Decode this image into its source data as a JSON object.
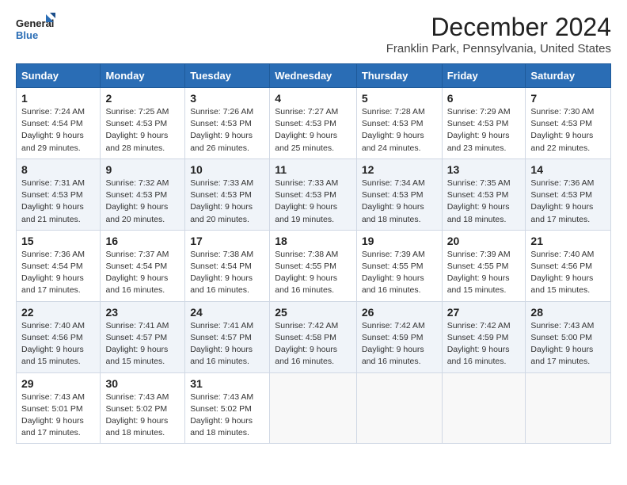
{
  "logo": {
    "line1": "General",
    "line2": "Blue"
  },
  "title": "December 2024",
  "location": "Franklin Park, Pennsylvania, United States",
  "days_of_week": [
    "Sunday",
    "Monday",
    "Tuesday",
    "Wednesday",
    "Thursday",
    "Friday",
    "Saturday"
  ],
  "weeks": [
    [
      {
        "day": "1",
        "sunrise": "7:24 AM",
        "sunset": "4:54 PM",
        "daylight": "9 hours and 29 minutes."
      },
      {
        "day": "2",
        "sunrise": "7:25 AM",
        "sunset": "4:53 PM",
        "daylight": "9 hours and 28 minutes."
      },
      {
        "day": "3",
        "sunrise": "7:26 AM",
        "sunset": "4:53 PM",
        "daylight": "9 hours and 26 minutes."
      },
      {
        "day": "4",
        "sunrise": "7:27 AM",
        "sunset": "4:53 PM",
        "daylight": "9 hours and 25 minutes."
      },
      {
        "day": "5",
        "sunrise": "7:28 AM",
        "sunset": "4:53 PM",
        "daylight": "9 hours and 24 minutes."
      },
      {
        "day": "6",
        "sunrise": "7:29 AM",
        "sunset": "4:53 PM",
        "daylight": "9 hours and 23 minutes."
      },
      {
        "day": "7",
        "sunrise": "7:30 AM",
        "sunset": "4:53 PM",
        "daylight": "9 hours and 22 minutes."
      }
    ],
    [
      {
        "day": "8",
        "sunrise": "7:31 AM",
        "sunset": "4:53 PM",
        "daylight": "9 hours and 21 minutes."
      },
      {
        "day": "9",
        "sunrise": "7:32 AM",
        "sunset": "4:53 PM",
        "daylight": "9 hours and 20 minutes."
      },
      {
        "day": "10",
        "sunrise": "7:33 AM",
        "sunset": "4:53 PM",
        "daylight": "9 hours and 20 minutes."
      },
      {
        "day": "11",
        "sunrise": "7:33 AM",
        "sunset": "4:53 PM",
        "daylight": "9 hours and 19 minutes."
      },
      {
        "day": "12",
        "sunrise": "7:34 AM",
        "sunset": "4:53 PM",
        "daylight": "9 hours and 18 minutes."
      },
      {
        "day": "13",
        "sunrise": "7:35 AM",
        "sunset": "4:53 PM",
        "daylight": "9 hours and 18 minutes."
      },
      {
        "day": "14",
        "sunrise": "7:36 AM",
        "sunset": "4:53 PM",
        "daylight": "9 hours and 17 minutes."
      }
    ],
    [
      {
        "day": "15",
        "sunrise": "7:36 AM",
        "sunset": "4:54 PM",
        "daylight": "9 hours and 17 minutes."
      },
      {
        "day": "16",
        "sunrise": "7:37 AM",
        "sunset": "4:54 PM",
        "daylight": "9 hours and 16 minutes."
      },
      {
        "day": "17",
        "sunrise": "7:38 AM",
        "sunset": "4:54 PM",
        "daylight": "9 hours and 16 minutes."
      },
      {
        "day": "18",
        "sunrise": "7:38 AM",
        "sunset": "4:55 PM",
        "daylight": "9 hours and 16 minutes."
      },
      {
        "day": "19",
        "sunrise": "7:39 AM",
        "sunset": "4:55 PM",
        "daylight": "9 hours and 16 minutes."
      },
      {
        "day": "20",
        "sunrise": "7:39 AM",
        "sunset": "4:55 PM",
        "daylight": "9 hours and 15 minutes."
      },
      {
        "day": "21",
        "sunrise": "7:40 AM",
        "sunset": "4:56 PM",
        "daylight": "9 hours and 15 minutes."
      }
    ],
    [
      {
        "day": "22",
        "sunrise": "7:40 AM",
        "sunset": "4:56 PM",
        "daylight": "9 hours and 15 minutes."
      },
      {
        "day": "23",
        "sunrise": "7:41 AM",
        "sunset": "4:57 PM",
        "daylight": "9 hours and 15 minutes."
      },
      {
        "day": "24",
        "sunrise": "7:41 AM",
        "sunset": "4:57 PM",
        "daylight": "9 hours and 16 minutes."
      },
      {
        "day": "25",
        "sunrise": "7:42 AM",
        "sunset": "4:58 PM",
        "daylight": "9 hours and 16 minutes."
      },
      {
        "day": "26",
        "sunrise": "7:42 AM",
        "sunset": "4:59 PM",
        "daylight": "9 hours and 16 minutes."
      },
      {
        "day": "27",
        "sunrise": "7:42 AM",
        "sunset": "4:59 PM",
        "daylight": "9 hours and 16 minutes."
      },
      {
        "day": "28",
        "sunrise": "7:43 AM",
        "sunset": "5:00 PM",
        "daylight": "9 hours and 17 minutes."
      }
    ],
    [
      {
        "day": "29",
        "sunrise": "7:43 AM",
        "sunset": "5:01 PM",
        "daylight": "9 hours and 17 minutes."
      },
      {
        "day": "30",
        "sunrise": "7:43 AM",
        "sunset": "5:02 PM",
        "daylight": "9 hours and 18 minutes."
      },
      {
        "day": "31",
        "sunrise": "7:43 AM",
        "sunset": "5:02 PM",
        "daylight": "9 hours and 18 minutes."
      },
      null,
      null,
      null,
      null
    ]
  ],
  "labels": {
    "sunrise": "Sunrise:",
    "sunset": "Sunset:",
    "daylight": "Daylight:"
  }
}
